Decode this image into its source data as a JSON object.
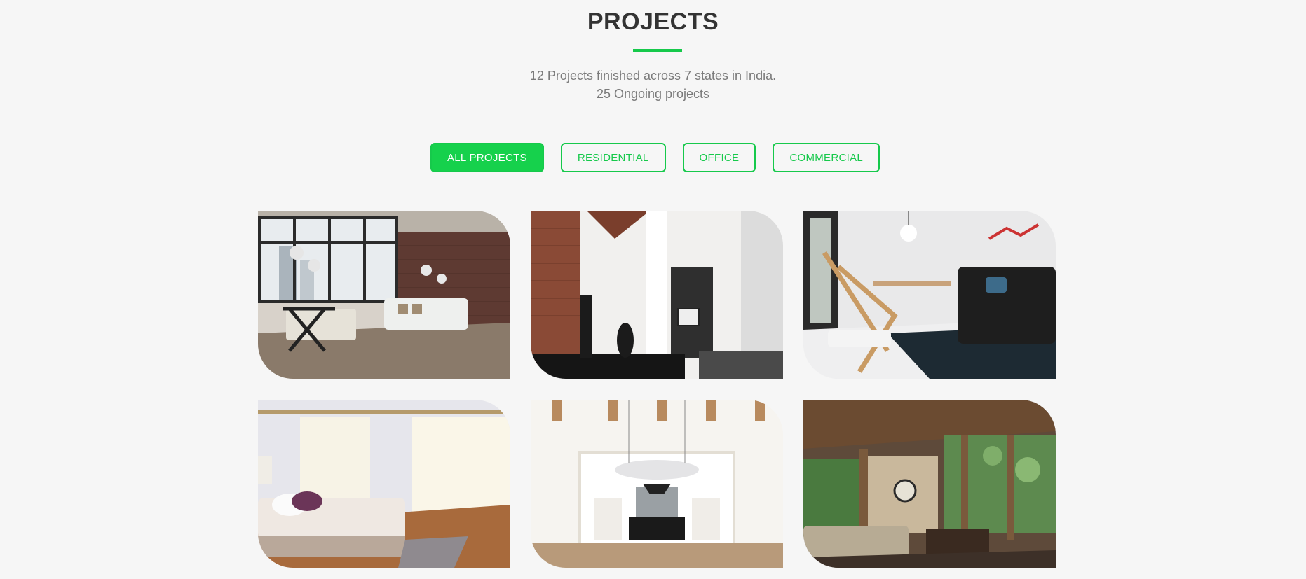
{
  "section": {
    "title": "PROJECTS",
    "subtitle_line1": "12 Projects finished across 7 states in India.",
    "subtitle_line2": "25 Ongoing projects"
  },
  "filters": [
    {
      "label": "ALL PROJECTS",
      "active": true
    },
    {
      "label": "RESIDENTIAL",
      "active": false
    },
    {
      "label": "OFFICE",
      "active": false
    },
    {
      "label": "COMMERCIAL",
      "active": false
    }
  ],
  "projects": [
    {
      "image": "living-room-brick-wall-image"
    },
    {
      "image": "loft-interior-image"
    },
    {
      "image": "dining-lounge-image"
    },
    {
      "image": "bedroom-image"
    },
    {
      "image": "kitchen-chandelier-image"
    },
    {
      "image": "porch-lounge-image"
    }
  ],
  "colors": {
    "accent": "#16c94b",
    "background": "#f6f6f6",
    "title": "#333333",
    "subtitle": "#7a7a7a"
  }
}
